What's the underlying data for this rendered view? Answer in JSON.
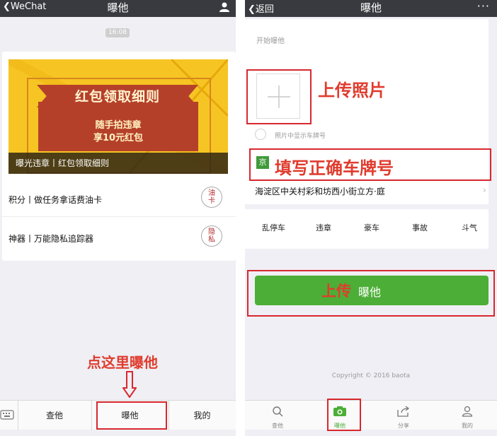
{
  "left": {
    "nav": {
      "back": "WeChat",
      "title": "曝他"
    },
    "timestamp": "16:08",
    "banner": {
      "ribbon": "红包领取细则",
      "line1": "随手拍违章",
      "line2": "享10元红包",
      "caption": "曝光违章丨红包领取细则"
    },
    "rows": [
      {
        "text": "积分丨做任务拿话费油卡",
        "badge_top": "油",
        "badge_bottom": "卡"
      },
      {
        "text": "神器丨万能隐私追踪器",
        "badge_top": "隐",
        "badge_bottom": "私"
      }
    ],
    "annotation": "点这里曝他",
    "tabs": [
      "查他",
      "曝他",
      "我的"
    ]
  },
  "right": {
    "nav": {
      "back": "返回",
      "title": "曝他",
      "more": "···"
    },
    "start_hint": "开始曝他",
    "annot_photo": "上传照片",
    "radio_hint": "照片中显示车牌号",
    "plate_prefix": "京",
    "annot_plate": "填写正确车牌号",
    "address": "海淀区中关村彩和坊西小街立方·庭",
    "categories": [
      "乱停车",
      "违章",
      "豪车",
      "事故",
      "斗气"
    ],
    "upload_red": "上传",
    "upload_white": "曝他",
    "copyright": "Copyright © 2016 baota",
    "tabs": [
      {
        "label": "查他",
        "icon": "search-icon"
      },
      {
        "label": "曝他",
        "icon": "camera-icon"
      },
      {
        "label": "分享",
        "icon": "share-icon"
      },
      {
        "label": "我的",
        "icon": "user-icon"
      }
    ]
  },
  "colors": {
    "nav": "#393a3f",
    "annotation_red": "#e03c2e",
    "button_green": "#4cae36",
    "banner_yellow": "#f6c523",
    "banner_red": "#b5402a"
  }
}
